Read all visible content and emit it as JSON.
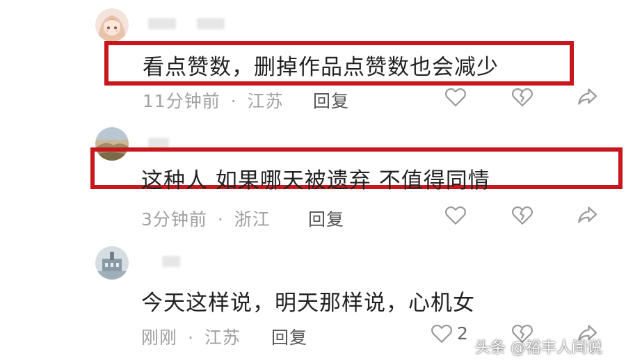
{
  "comments": [
    {
      "text": "看点赞数，删掉作品点赞数也会减少",
      "time": "11分钟前",
      "separator": "·",
      "location": "江苏",
      "reply_label": "回复",
      "highlighted": true,
      "like_count": ""
    },
    {
      "text": "这种人 如果哪天被遗弃 不值得同情",
      "time": "3分钟前",
      "separator": "·",
      "location": "浙江",
      "reply_label": "回复",
      "highlighted": true,
      "like_count": ""
    },
    {
      "text": "今天这样说，明天那样说，心机女",
      "time": "刚刚",
      "separator": "·",
      "location": "江苏",
      "reply_label": "回复",
      "highlighted": false,
      "like_count": "2"
    }
  ],
  "icons": {
    "like": "heart-outline-icon",
    "dislike": "broken-heart-icon",
    "share": "share-arrow-icon"
  },
  "colors": {
    "highlight_border": "#c8161d",
    "meta_text": "#a0a0a0",
    "body_text": "#222222"
  },
  "watermark": "头条 @裕丰人间说"
}
